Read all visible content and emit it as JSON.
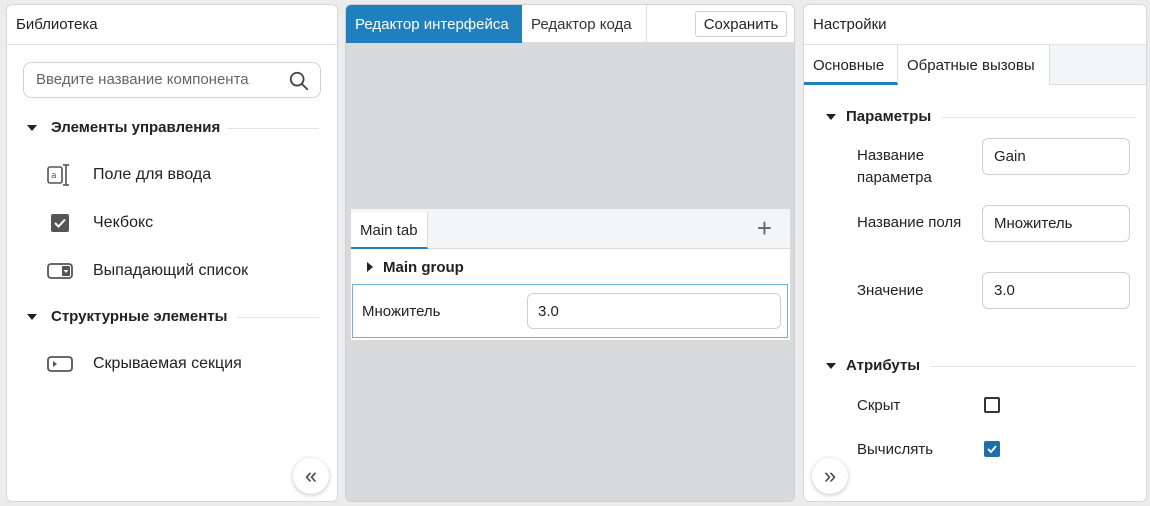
{
  "library": {
    "title": "Библиотека",
    "search_placeholder": "Введите название компонента",
    "categories": [
      {
        "label": "Элементы управления",
        "items": [
          "Поле для ввода",
          "Чекбокс",
          "Выпадающий список"
        ]
      },
      {
        "label": "Структурные элементы",
        "items": [
          "Скрываемая секция"
        ]
      }
    ],
    "collapse_icon": "«"
  },
  "editor": {
    "tabs": [
      "Редактор интерфейса",
      "Редактор кода"
    ],
    "save_label": "Сохранить",
    "card": {
      "tab_label": "Main tab",
      "add_icon": "+",
      "group_label": "Main group",
      "field_label": "Множитель",
      "field_value": "3.0"
    }
  },
  "settings": {
    "title": "Настройки",
    "tabs": [
      "Основные",
      "Обратные вызовы"
    ],
    "params_section": "Параметры",
    "params": [
      {
        "label": "Название параметра",
        "value": "Gain"
      },
      {
        "label": "Название поля",
        "value": "Множитель"
      },
      {
        "label": "Значение",
        "value": "3.0"
      }
    ],
    "attrs_section": "Атрибуты",
    "attrs": [
      {
        "label": "Скрыт",
        "checked": false
      },
      {
        "label": "Вычислять",
        "checked": true
      }
    ],
    "expand_icon": "»"
  },
  "colors": {
    "accent": "#1f80bd",
    "canvas": "#d8dadc"
  }
}
